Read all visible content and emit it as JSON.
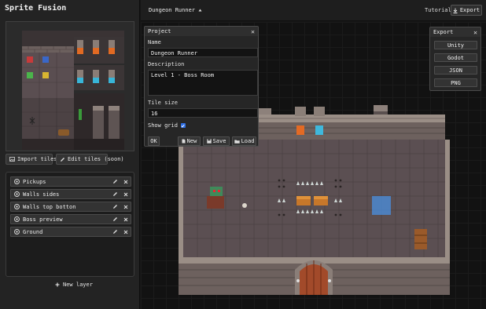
{
  "app": {
    "title": "Sprite Fusion"
  },
  "sidebar": {
    "import_label": "Import tileset",
    "edit_label": "Edit tiles (soon)",
    "layers": [
      {
        "name": "Pickups"
      },
      {
        "name": "Walls sides"
      },
      {
        "name": "Walls top botton"
      },
      {
        "name": "Boss preview"
      },
      {
        "name": "Ground"
      }
    ],
    "new_layer_label": "New layer"
  },
  "topbar": {
    "project_name": "Dungeon Runner",
    "tutorial_label": "Tutorial",
    "export_label": "Export"
  },
  "project_panel": {
    "title": "Project",
    "name_label": "Name",
    "name_value": "Dungeon Runner",
    "description_label": "Description",
    "description_value": "Level 1 - Boss Room",
    "tile_size_label": "Tile size",
    "tile_size_value": "16",
    "show_grid_label": "Show grid",
    "show_grid_checked": true,
    "ok_label": "OK",
    "new_label": "New",
    "save_label": "Save",
    "load_label": "Load"
  },
  "export_panel": {
    "title": "Export",
    "options": [
      "Unity",
      "Godot",
      "JSON",
      "PNG"
    ]
  },
  "colors": {
    "accent": "#2f6fe4",
    "selection": "#4a8fe0",
    "floor": "#5b4f52",
    "wall": "#6a5e5c",
    "wall_top": "#8a7e78"
  }
}
